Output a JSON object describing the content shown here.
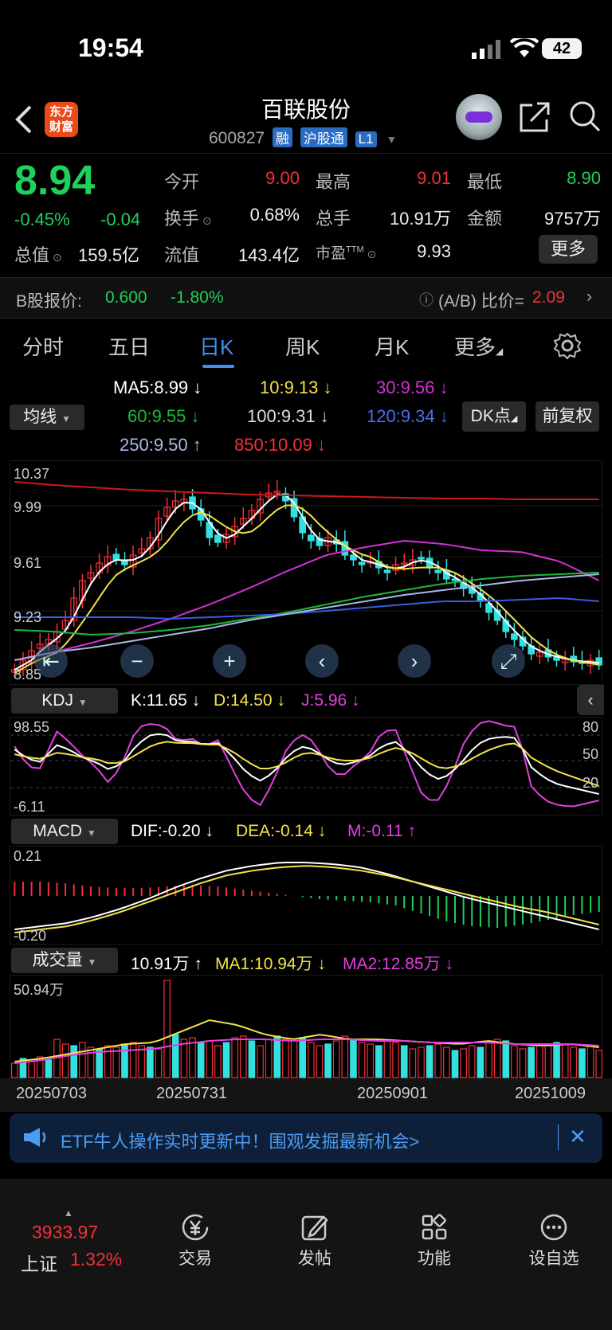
{
  "status": {
    "time": "19:54",
    "battery": "42"
  },
  "header": {
    "logo_line1": "东方",
    "logo_line2": "财富",
    "name": "百联股份",
    "code": "600827",
    "tags": [
      "融",
      "沪股通",
      "L1"
    ]
  },
  "quote": {
    "price": "8.94",
    "pct": "-0.45%",
    "chg": "-0.04",
    "open_lbl": "今开",
    "open": "9.00",
    "high_lbl": "最高",
    "high": "9.01",
    "low_lbl": "最低",
    "low": "8.90",
    "turnover_lbl": "换手",
    "turnover": "0.68%",
    "vol_lbl": "总手",
    "vol": "10.91万",
    "amount_lbl": "金额",
    "amount": "9757万",
    "mcap_lbl": "总值",
    "mcap": "159.5亿",
    "float_lbl": "流值",
    "float": "143.4亿",
    "pe_lbl": "市盈",
    "pe_sup": "TTM",
    "pe": "9.93",
    "more": "更多"
  },
  "bshare": {
    "label": "B股报价:",
    "price": "0.600",
    "pct": "-1.80%",
    "ratio_lbl": "(A/B) 比价=",
    "ratio": "2.09"
  },
  "tabs": [
    "分时",
    "五日",
    "日K",
    "周K",
    "月K",
    "更多"
  ],
  "ma": {
    "selector": "均线",
    "ma5": "MA5:8.99 ↓",
    "ma10": "10:9.13 ↓",
    "ma30": "30:9.56 ↓",
    "ma60": "60:9.55 ↓",
    "ma100": "100:9.31 ↓",
    "ma120": "120:9.34 ↓",
    "ma250": "250:9.50 ↑",
    "ma850": "850:10.09 ↓",
    "dk": "DK点",
    "fq": "前复权"
  },
  "kline": {
    "ymax": "10.37",
    "y2": "9.99",
    "y3": "9.61",
    "y4": "9.23",
    "y5": "8.85"
  },
  "kdj": {
    "selector": "KDJ",
    "k": "K:11.65 ↓",
    "d": "D:14.50 ↓",
    "j": "J:5.96 ↓",
    "max": "98.55",
    "min": "-6.11",
    "l80": "80",
    "l50": "50",
    "l20": "20"
  },
  "macd": {
    "selector": "MACD",
    "dif": "DIF:-0.20 ↓",
    "dea": "DEA:-0.14 ↓",
    "m": "M:-0.11 ↑",
    "max": "0.21",
    "min": "-0.20"
  },
  "volume": {
    "selector": "成交量",
    "v": "10.91万 ↑",
    "ma1": "MA1:10.94万 ↓",
    "ma2": "MA2:12.85万 ↓",
    "max": "50.94万"
  },
  "dates": [
    "20250703",
    "20250731",
    "20250901",
    "20251009"
  ],
  "banner": {
    "text": "ETF牛人操作实时更新中！围观发掘最新机会>"
  },
  "bottom": {
    "index_value": "3933.97",
    "index_name": "上证",
    "index_pct": "1.32%",
    "nav": [
      "交易",
      "发帖",
      "功能",
      "设自选"
    ]
  },
  "colors": {
    "up": "#f2303a",
    "down": "#1fd05a",
    "accent": "#3f8ef0",
    "ma5": "#ffffff",
    "ma10": "#f4e24a",
    "ma30": "#d630d6",
    "ma60": "#1fb83a",
    "ma120": "#3a5de0",
    "ma250": "#aab8e6",
    "ma850": "#d01818"
  }
}
